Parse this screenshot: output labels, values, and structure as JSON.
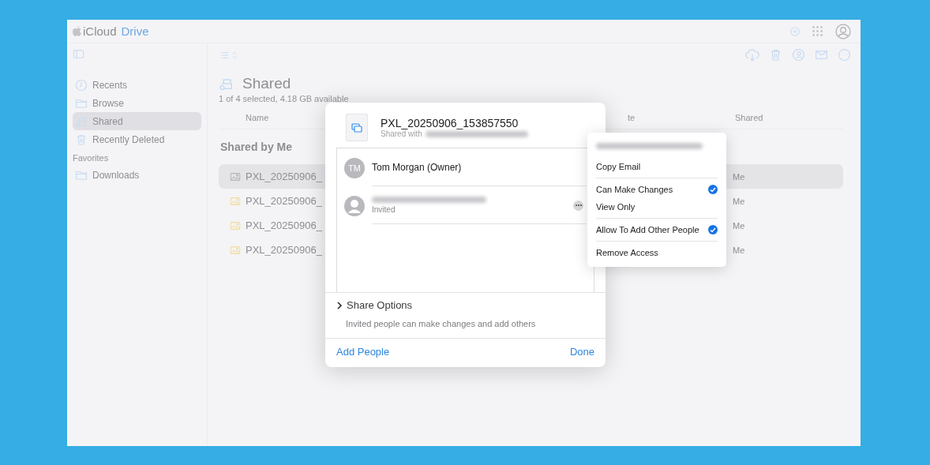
{
  "app": {
    "brand": "iCloud",
    "product": "Drive"
  },
  "sidebar": {
    "items": [
      {
        "label": "Recents",
        "selected": false
      },
      {
        "label": "Browse",
        "selected": false
      },
      {
        "label": "Shared",
        "selected": true
      },
      {
        "label": "Recently Deleted",
        "selected": false
      }
    ],
    "favorites_heading": "Favorites",
    "favorites": [
      {
        "label": "Downloads",
        "selected": false
      }
    ]
  },
  "main": {
    "title": "Shared",
    "subtitle": "1 of 4 selected, 4.18 GB available",
    "columns": [
      "Name",
      "te",
      "Shared"
    ],
    "section": "Shared by Me",
    "rows": [
      {
        "name": "PXL_20250906_",
        "shared": "Me",
        "selected": true
      },
      {
        "name": "PXL_20250906_",
        "shared": "Me",
        "selected": false
      },
      {
        "name": "PXL_20250906_",
        "shared": "Me",
        "selected": false
      },
      {
        "name": "PXL_20250906_",
        "shared": "Me",
        "selected": false
      }
    ]
  },
  "share_dialog": {
    "file_name": "PXL_20250906_153857550",
    "shared_with_label": "Shared with",
    "participants": [
      {
        "kind": "owner",
        "initials": "TM",
        "name": "Tom Morgan (Owner)"
      },
      {
        "kind": "invited",
        "status": "Invited"
      }
    ],
    "share_options": {
      "label": "Share Options",
      "expanded": false,
      "description": "Invited people can make changes and add others"
    },
    "buttons": [
      "Add People",
      "Done"
    ]
  },
  "context_menu": {
    "sections": [
      [
        {
          "label": "Copy Email",
          "checked": false
        }
      ],
      [
        {
          "label": "Can Make Changes",
          "checked": true
        },
        {
          "label": "View Only",
          "checked": false
        }
      ],
      [
        {
          "label": "Allow To Add Other People",
          "checked": true
        }
      ],
      [
        {
          "label": "Remove Access",
          "checked": false
        }
      ]
    ]
  }
}
